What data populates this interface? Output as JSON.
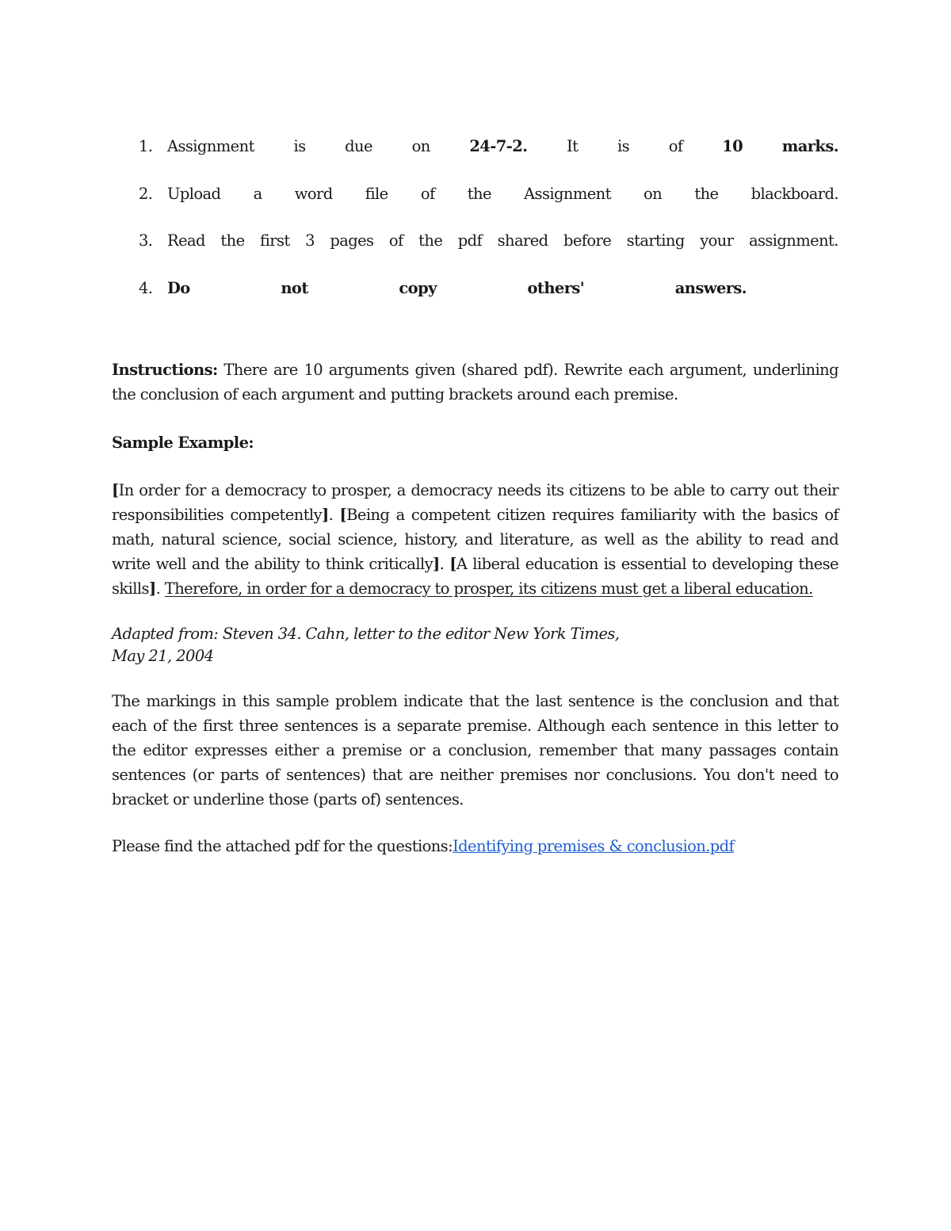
{
  "rules": [
    {
      "number": "1.",
      "words": [
        "Assignment",
        "is",
        "due",
        "on",
        "24-7-2.",
        "It",
        "is",
        "of",
        "10",
        "marks."
      ],
      "bold": [
        4,
        8,
        9
      ]
    },
    {
      "number": "2.",
      "words": [
        "Upload",
        "a",
        "word",
        "file",
        "of",
        "the",
        "Assignment",
        "on",
        "the",
        "blackboard."
      ],
      "bold": []
    },
    {
      "number": "3.",
      "words": [
        "Read",
        "the",
        "first",
        "3",
        "pages",
        "of",
        "the",
        "pdf",
        "shared",
        "before",
        "starting",
        "your",
        "assignment."
      ],
      "bold": []
    },
    {
      "number": "4.",
      "words": [
        "Do",
        "not",
        "copy",
        "others'",
        "answers."
      ],
      "bold": [
        0,
        1,
        2,
        3,
        4
      ]
    }
  ],
  "instructions": {
    "label": "Instructions:",
    "text": " There are 10 arguments given (shared pdf). Rewrite each argument, underlining the conclusion of each argument and putting brackets around each premise."
  },
  "sample_heading": "Sample Example:",
  "example": {
    "premise_1": "In order for a democracy to prosper, a democracy needs its citizens to be able to carry out their responsibilities competently",
    "premise_2": "Being a competent citizen requires familiarity with the basics of math, natural science, social science, history, and literature, as well as the ability to read and write well and the ability to think critically",
    "premise_3": "A liberal education is essential to developing these skills",
    "conclusion": "Therefore, in order for a democracy to prosper, its citizens must get a liberal education."
  },
  "citation": {
    "line1": "Adapted from: Steven 34. Cahn, letter to the editor New York Times,",
    "line2": "May 21, 2004"
  },
  "explanation": "The markings in this sample problem indicate that the last sentence is the conclusion and that each of the first three sentences is a separate premise. Although each sentence in this letter to the editor expresses either a premise or a conclusion, remember that many passages contain sentences (or parts of sentences) that are neither premises nor conclusions. You don't need to bracket or underline those (parts of) sentences.",
  "closing": {
    "text": "Please find the attached pdf for the questions:",
    "link_label": "Identifying premises & conclusion.pdf",
    "link_color": "#1e5fd1"
  }
}
